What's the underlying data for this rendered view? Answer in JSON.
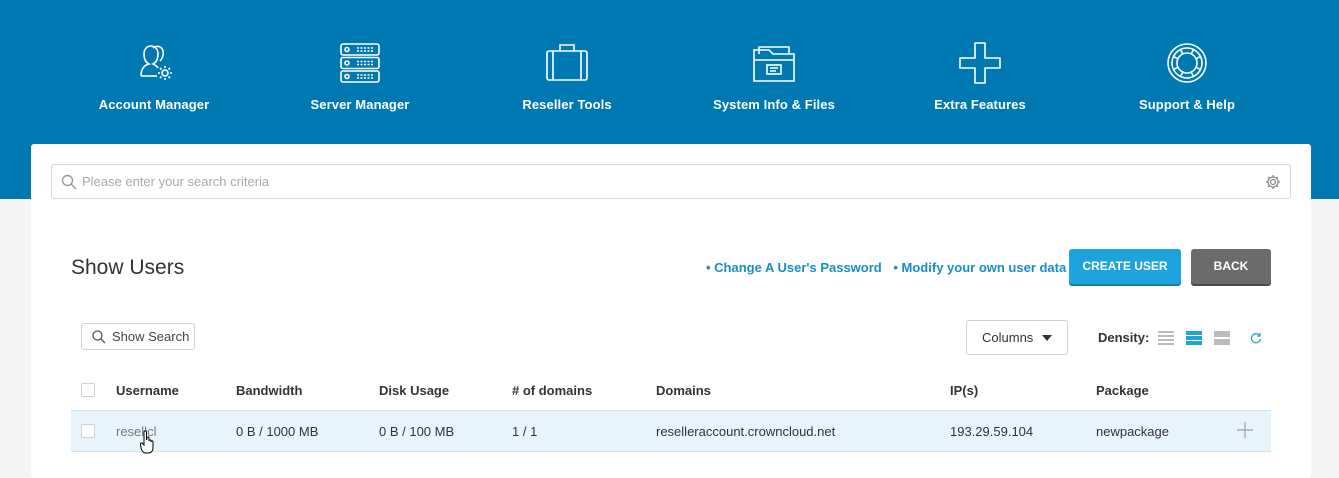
{
  "nav": {
    "items": [
      {
        "label": "Account Manager",
        "icon": "account-manager-icon"
      },
      {
        "label": "Server Manager",
        "icon": "server-manager-icon"
      },
      {
        "label": "Reseller Tools",
        "icon": "briefcase-icon"
      },
      {
        "label": "System Info & Files",
        "icon": "folder-icon"
      },
      {
        "label": "Extra Features",
        "icon": "plus-icon"
      },
      {
        "label": "Support & Help",
        "icon": "lifebuoy-icon"
      }
    ]
  },
  "search": {
    "placeholder": "Please enter your search criteria",
    "value": ""
  },
  "page": {
    "title": "Show Users"
  },
  "links": {
    "change_password": "• Change A User's Password",
    "modify_data": "• Modify your own user data"
  },
  "buttons": {
    "create": "CREATE USER",
    "back": "BACK"
  },
  "toolbar": {
    "show_search": "Show Search",
    "columns": "Columns",
    "density_label": "Density:",
    "density_selected": "medium"
  },
  "table": {
    "headers": [
      "Username",
      "Bandwidth",
      "Disk Usage",
      "# of domains",
      "Domains",
      "IP(s)",
      "Package"
    ],
    "rows": [
      {
        "username": "resellcl",
        "bandwidth": "0 B / 1000 MB",
        "disk": "0 B / 100 MB",
        "domains_count": "1 / 1",
        "domains": "reselleraccount.crowncloud.net",
        "ips": "193.29.59.104",
        "package": "newpackage"
      }
    ]
  },
  "colors": {
    "header_bg": "#0079b2",
    "accent": "#1fa3dd",
    "link": "#1a8cc8",
    "row_highlight": "#e8f4fb",
    "back_button": "#6b6b6b"
  }
}
